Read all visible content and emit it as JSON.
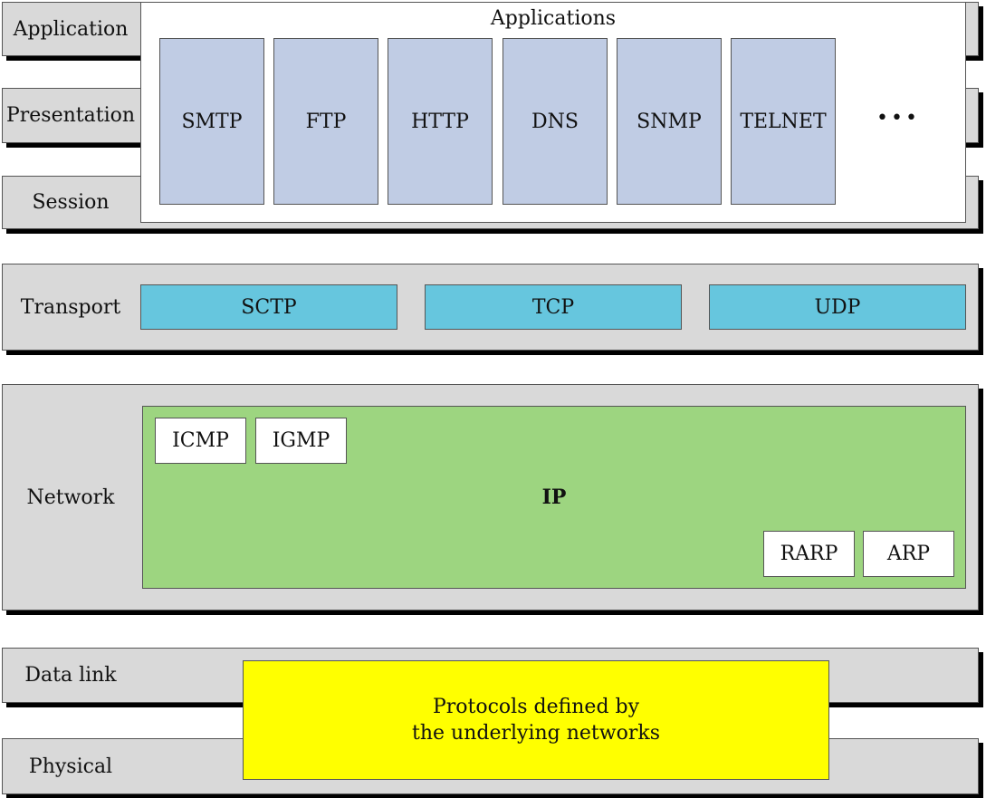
{
  "layers": {
    "application": "Application",
    "presentation": "Presentation",
    "session": "Session",
    "transport": "Transport",
    "network": "Network",
    "data_link": "Data link",
    "physical": "Physical"
  },
  "applications": {
    "title": "Applications",
    "protocols": [
      "SMTP",
      "FTP",
      "HTTP",
      "DNS",
      "SNMP",
      "TELNET"
    ],
    "more": "•••"
  },
  "transport": {
    "protocols": [
      "SCTP",
      "TCP",
      "UDP"
    ]
  },
  "network": {
    "main": "IP",
    "top": [
      "ICMP",
      "IGMP"
    ],
    "bottom": [
      "RARP",
      "ARP"
    ]
  },
  "lower": {
    "line1": "Protocols defined by",
    "line2": "the underlying networks"
  },
  "colors": {
    "band": "#d9d9d9",
    "app_box": "#c0cce4",
    "transport_box": "#66c6de",
    "ip_box": "#9dd580",
    "lower_box": "#ffff00"
  }
}
